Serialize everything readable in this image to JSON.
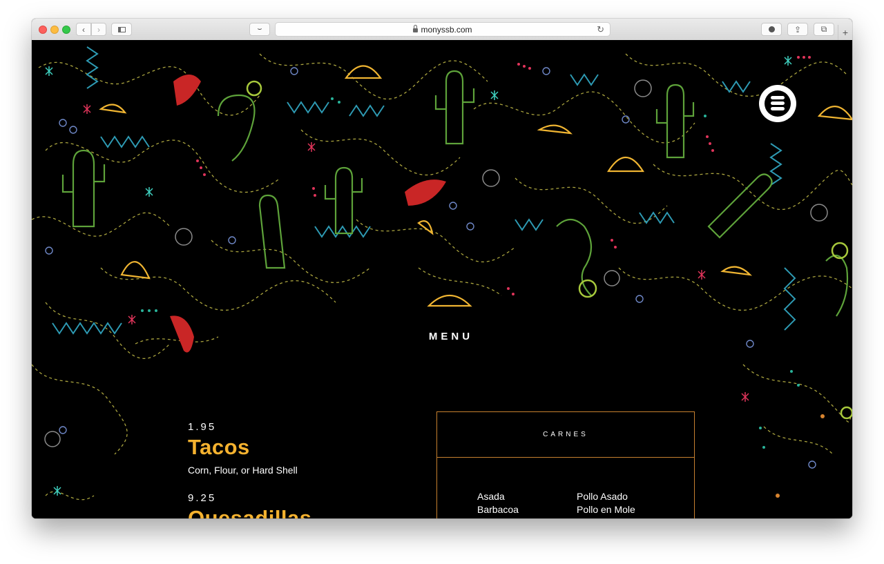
{
  "browser": {
    "url": "monyssb.com",
    "buttons": {
      "back_icon": "chevron-left-icon",
      "forward_icon": "chevron-right-icon",
      "sidebar_icon": "sidebar-icon",
      "download_icon": "download-icon",
      "share_icon": "share-icon",
      "tabs_icon": "tabs-icon",
      "reload_icon": "reload-icon",
      "new_tab_icon": "plus-icon"
    },
    "colors": {
      "close": "#fc605c",
      "minimize": "#fdbc40",
      "zoom": "#34c84a"
    }
  },
  "site": {
    "menu_label": "MENU",
    "logo_icon": "monys-logo-icon",
    "colors": {
      "background": "#000000",
      "accent": "#f5b22f",
      "box_border": "#c8812f"
    },
    "items": [
      {
        "price": "1.95",
        "name": "Tacos",
        "description": "Corn, Flour, or Hard Shell"
      },
      {
        "price": "9.25",
        "name": "Quesadillas",
        "description": ""
      }
    ],
    "carnes": {
      "title": "CARNES",
      "left": [
        "Asada",
        "Barbacoa"
      ],
      "right": [
        "Pollo Asado",
        "Pollo en Mole"
      ]
    }
  }
}
